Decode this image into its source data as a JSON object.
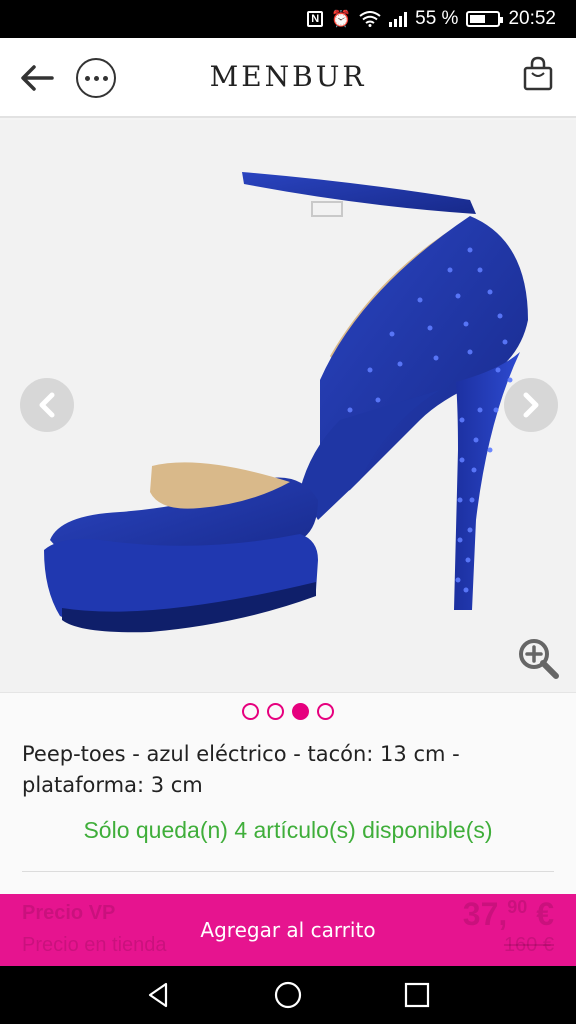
{
  "status_bar": {
    "battery_percent": "55 %",
    "time": "20:52",
    "icons": [
      "nfc-icon",
      "alarm-icon",
      "wifi-icon",
      "signal-icon",
      "battery-icon"
    ]
  },
  "header": {
    "brand": "MENBUR",
    "icons": [
      "back-arrow-icon",
      "more-options-icon",
      "shopping-bag-icon"
    ]
  },
  "gallery": {
    "image_count": 4,
    "active_index": 2,
    "icons": [
      "chevron-left-icon",
      "chevron-right-icon",
      "zoom-in-icon"
    ]
  },
  "product": {
    "title": "Peep-toes - azul eléctrico - tacón: 13 cm - plataforma: 3 cm",
    "stock_note": "Sólo queda(n) 4 artículo(s) disponible(s)"
  },
  "buy_bar": {
    "price_vp_label": "Precio VP",
    "price_store_label": "Precio en tienda",
    "price_vp_int": "37,",
    "price_vp_dec": "90",
    "price_vp_currency": " €",
    "price_store": "160 €",
    "add_to_cart": "Agregar al carrito"
  },
  "colors": {
    "accent": "#e6148f",
    "stock_green": "#3fae3a",
    "shoe_blue": "#1e36a8"
  }
}
